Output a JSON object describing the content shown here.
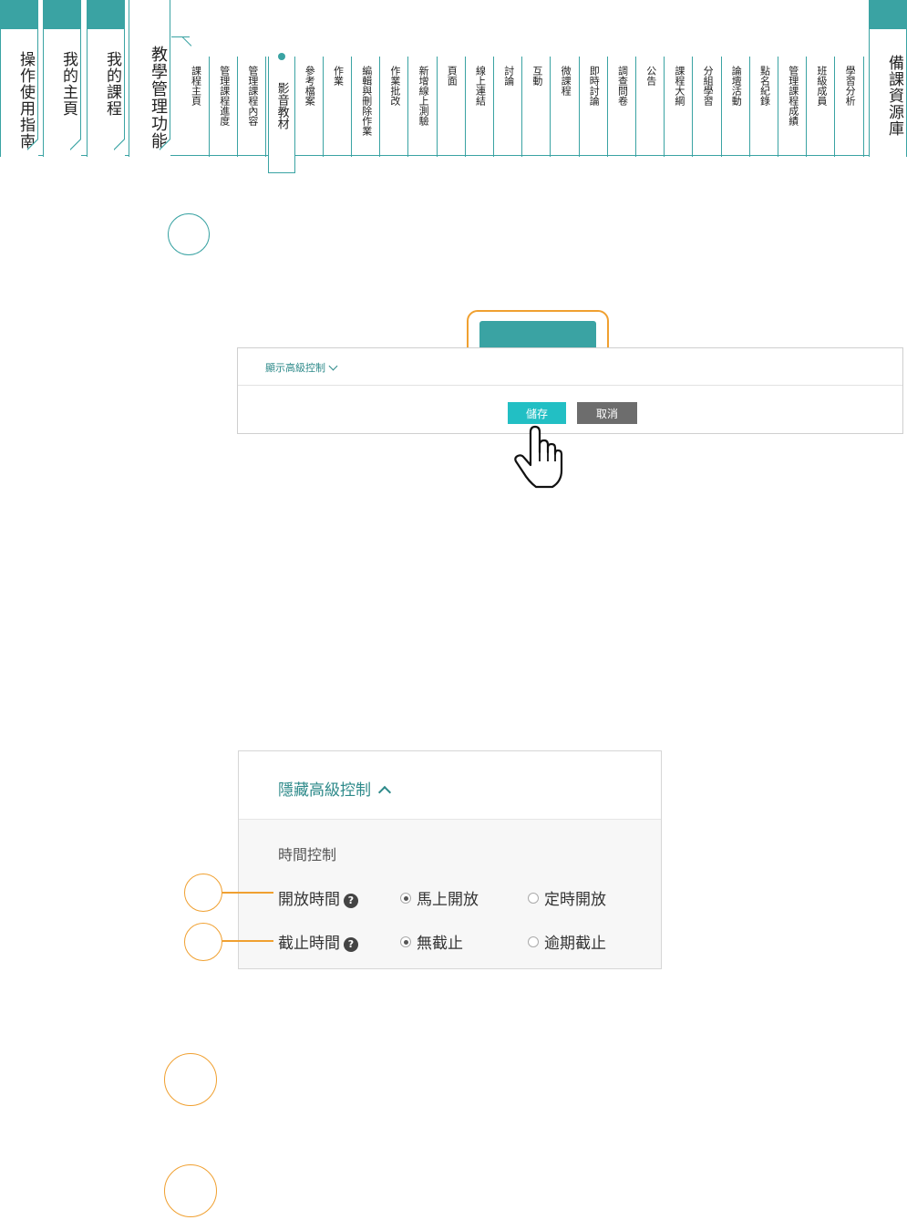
{
  "nav": {
    "main_tabs": [
      {
        "label": "操作使用指南"
      },
      {
        "label": "我的主頁"
      },
      {
        "label": "我的課程"
      },
      {
        "label": "教學管理功能"
      }
    ],
    "sub_items": [
      "課程主頁",
      "管理課程進度",
      "管理課程內容",
      "影音教材",
      "參考檔案",
      "作業",
      "編輯與刪除作業",
      "作業批改",
      "新增線上測驗",
      "頁面",
      "線上連結",
      "討論",
      "互動",
      "微課程",
      "即時討論",
      "調查問卷",
      "公告",
      "課程大綱",
      "分組學習",
      "論壇活動",
      "點名紀錄",
      "管理課程成績",
      "班級成員",
      "學習分析"
    ],
    "active_sub": "影音教材",
    "right_tab": "備課資源庫"
  },
  "shot1": {
    "advanced_toggle": "顯示高級控制",
    "save_label": "儲存",
    "cancel_label": "取消"
  },
  "shot2": {
    "advanced_toggle": "隱藏高級控制",
    "section_title": "時間控制",
    "open_time": {
      "label": "開放時間",
      "help": "?",
      "options": [
        "馬上開放",
        "定時開放"
      ],
      "selected": "馬上開放"
    },
    "close_time": {
      "label": "截止時間",
      "help": "?",
      "options": [
        "無截止",
        "逾期截止"
      ],
      "selected": "無截止"
    }
  },
  "colors": {
    "accent": "#3aa3a3",
    "highlight": "#f0a030",
    "save_button": "#22bfc4",
    "cancel_button": "#6d6d6d"
  }
}
